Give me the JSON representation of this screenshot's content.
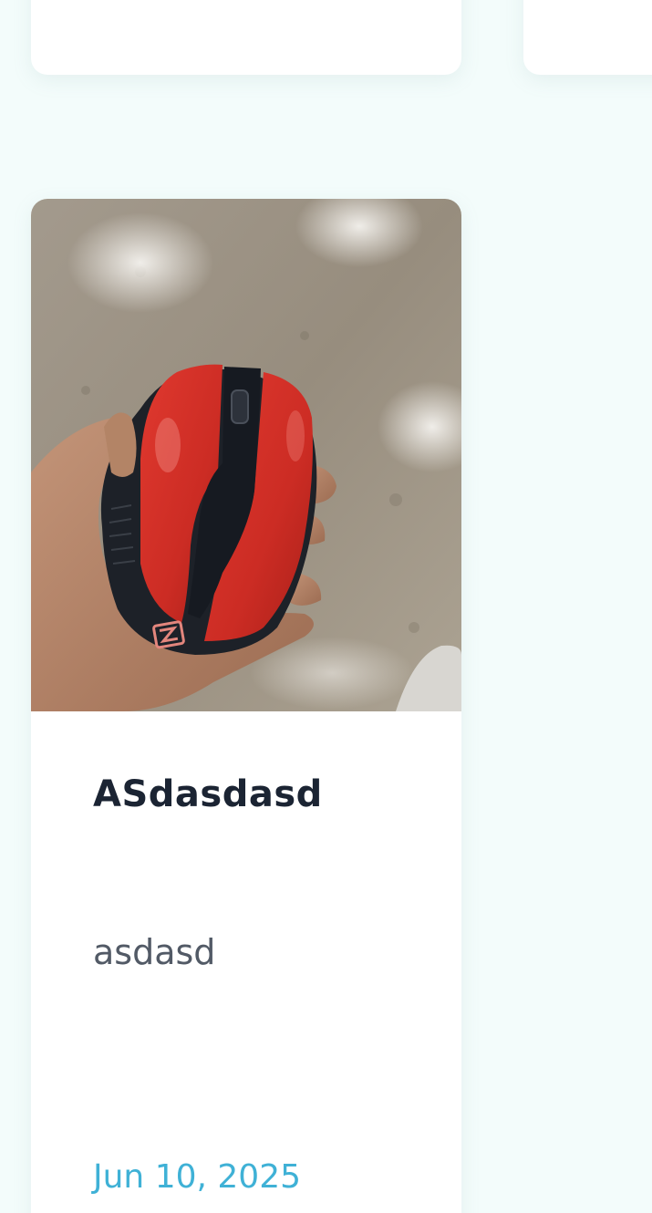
{
  "post": {
    "title": "ASdasdasd",
    "description": "asdasd",
    "date": "Jun 10, 2025",
    "image": {
      "subject": "red and black wireless mouse held in a hand",
      "logo_text": "Z"
    }
  },
  "colors": {
    "page_background": "#f3fcfb",
    "card_background": "#ffffff",
    "title": "#1b2433",
    "description": "#525a66",
    "date": "#3fb1d6",
    "mouse_red": "#d8322a",
    "mouse_black": "#1d2128"
  }
}
